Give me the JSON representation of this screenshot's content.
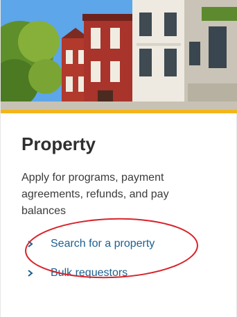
{
  "card": {
    "title": "Property",
    "description": "Apply for programs, payment agreements, refunds, and pay balances",
    "links": [
      {
        "label": "Search for a property",
        "icon": "chevron-right-icon"
      },
      {
        "label": "Bulk requestors",
        "icon": "chevron-right-icon"
      }
    ]
  },
  "colors": {
    "accent": "#f2b51c",
    "link": "#1c5f8f",
    "annotation": "#d8232a"
  }
}
